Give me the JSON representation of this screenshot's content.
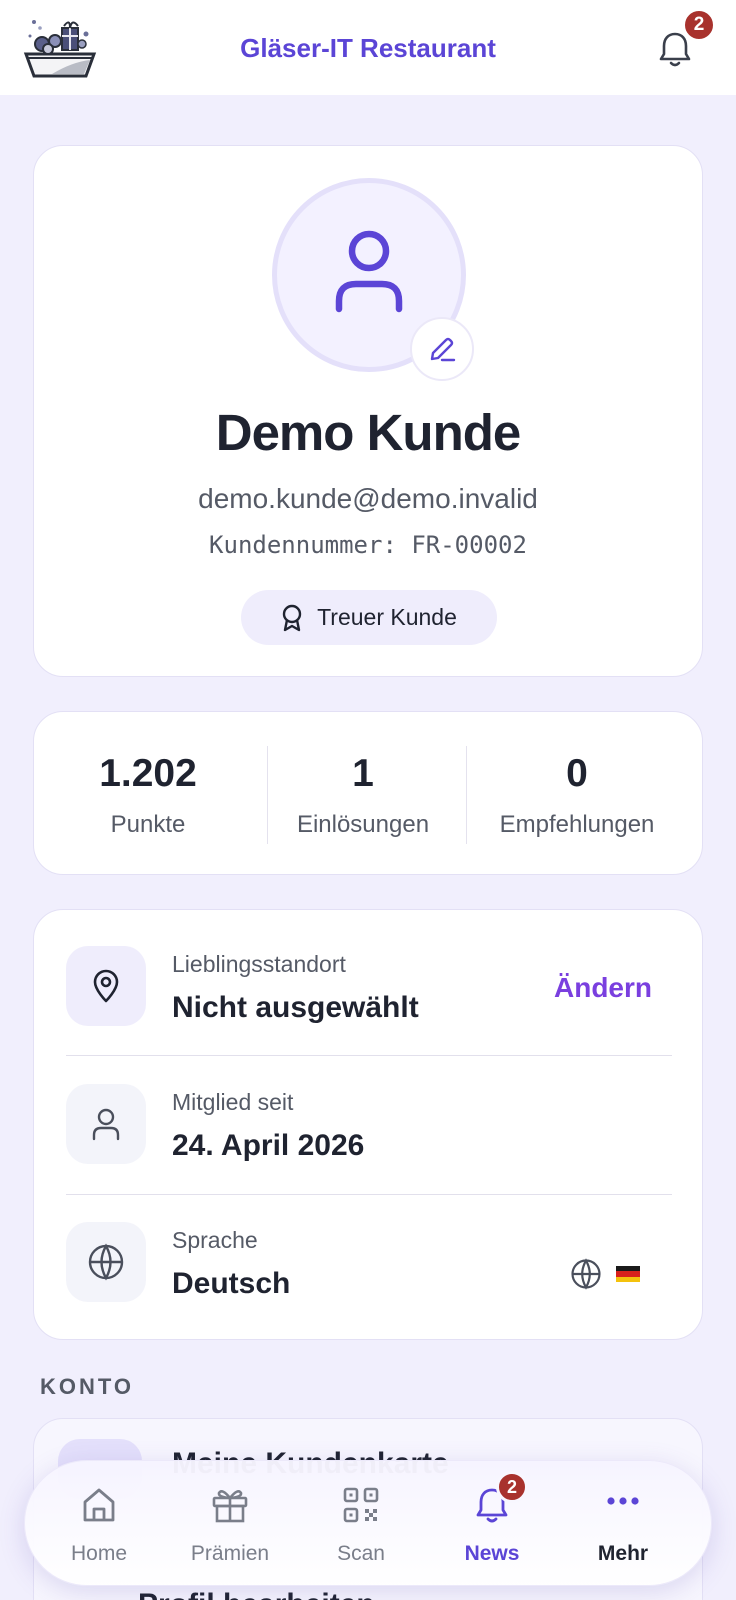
{
  "header": {
    "title": "Gläser-IT Restaurant",
    "notification_count": "2"
  },
  "profile": {
    "name": "Demo Kunde",
    "email": "demo.kunde@demo.invalid",
    "customer_number": "Kundennummer: FR-00002",
    "tier": "Treuer Kunde"
  },
  "stats": [
    {
      "value": "1.202",
      "label": "Punkte"
    },
    {
      "value": "1",
      "label": "Einlösungen"
    },
    {
      "value": "0",
      "label": "Empfehlungen"
    }
  ],
  "info": {
    "location": {
      "label": "Lieblingsstandort",
      "value": "Nicht ausgewählt",
      "action": "Ändern"
    },
    "member": {
      "label": "Mitglied seit",
      "value": "24. April 2026"
    },
    "language": {
      "label": "Sprache",
      "value": "Deutsch"
    }
  },
  "section": {
    "title": "KONTO",
    "item_1": "Meine Kundenkarte",
    "item_2": "Profil bearbeiten"
  },
  "tabbar": {
    "tabs": [
      {
        "label": "Home",
        "icon": "home-icon"
      },
      {
        "label": "Prämien",
        "icon": "gift-icon"
      },
      {
        "label": "Scan",
        "icon": "qr-code-icon"
      },
      {
        "label": "News",
        "icon": "bell-icon",
        "badge": "2"
      },
      {
        "label": "Mehr",
        "icon": "more-dots-icon"
      }
    ],
    "active": "News"
  },
  "colors": {
    "accent": "#5b45d6",
    "link": "#7a3fdf",
    "badge": "#a8322d",
    "background": "#f1effd"
  }
}
